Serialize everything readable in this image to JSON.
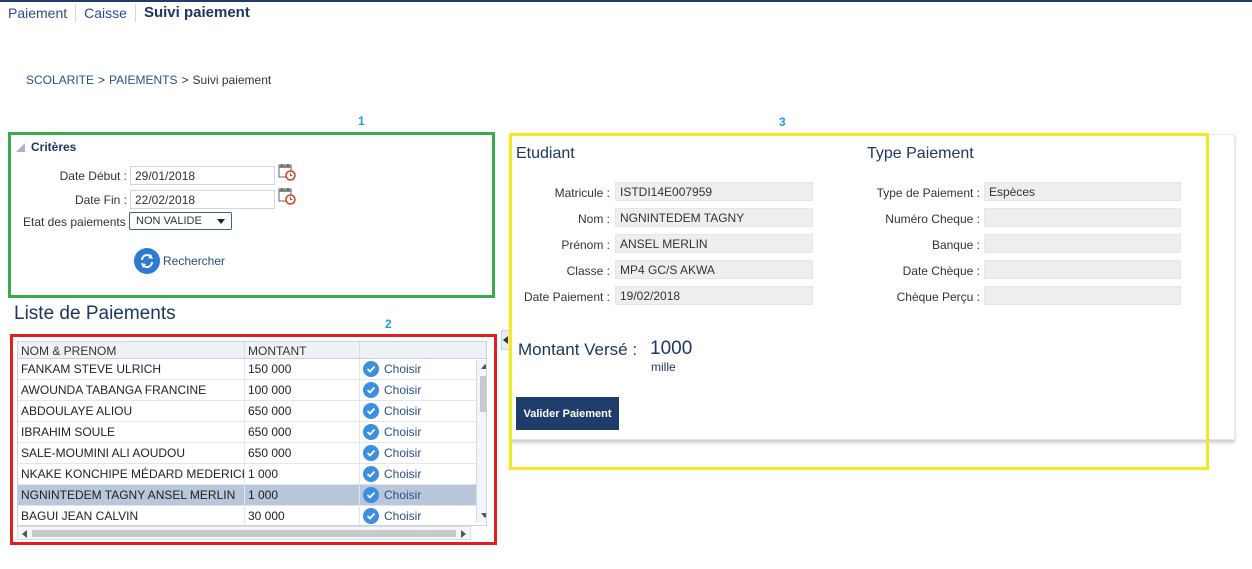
{
  "tabs": [
    {
      "label": "Paiement"
    },
    {
      "label": "Caisse"
    },
    {
      "label": "Suivi paiement"
    }
  ],
  "breadcrumb": {
    "items": [
      "SCOLARITE",
      "PAIEMENTS",
      "Suivi paiement"
    ],
    "separator": ">"
  },
  "badges": {
    "criteria": "1",
    "list": "2",
    "detail": "3"
  },
  "criteria": {
    "title": "Critères",
    "date_debut_label": "Date Début :",
    "date_debut_value": "29/01/2018",
    "date_fin_label": "Date Fin :",
    "date_fin_value": "22/02/2018",
    "etat_label": "Etat des paiements",
    "etat_value": "NON VALIDE",
    "search_label": "Rechercher"
  },
  "list": {
    "title": "Liste de Paiements",
    "columns": [
      "NOM & PRENOM",
      "MONTANT",
      ""
    ],
    "choose_label": "Choisir",
    "rows": [
      {
        "name": "FANKAM STEVE ULRICH",
        "amount": "150 000"
      },
      {
        "name": "AWOUNDA TABANGA FRANCINE",
        "amount": "100 000"
      },
      {
        "name": "ABDOULAYE ALIOU",
        "amount": "650 000"
      },
      {
        "name": "IBRAHIM SOULE",
        "amount": "650 000"
      },
      {
        "name": "SALE-MOUMINI ALI AOUDOU",
        "amount": "650 000"
      },
      {
        "name": "NKAKE KONCHIPE MÉDARD MEDERICK",
        "amount": "1 000"
      },
      {
        "name": "NGNINTEDEM TAGNY ANSEL MERLIN",
        "amount": "1 000"
      },
      {
        "name": "BAGUI JEAN CALVIN",
        "amount": "30 000"
      }
    ]
  },
  "etudiant": {
    "title": "Etudiant",
    "matricule_label": "Matricule :",
    "matricule": "ISTDI14E007959",
    "nom_label": "Nom :",
    "nom": "NGNINTEDEM TAGNY",
    "prenom_label": "Prénom :",
    "prenom": "ANSEL MERLIN",
    "classe_label": "Classe :",
    "classe": "MP4 GC/S AKWA",
    "date_paiement_label": "Date Paiement :",
    "date_paiement": "19/02/2018"
  },
  "type_paiement": {
    "title": "Type Paiement",
    "type_label": "Type de Paiement :",
    "type": "Espèces",
    "numero_label": "Numéro Cheque :",
    "numero": "",
    "banque_label": "Banque :",
    "banque": "",
    "date_cheque_label": "Date Chèque :",
    "date_cheque": "",
    "cheque_percu_label": "Chèque Perçu :",
    "cheque_percu": ""
  },
  "montant": {
    "label": "Montant Versé :",
    "value": "1000",
    "words": "mille"
  },
  "valider_label": "Valider Paiement",
  "colors": {
    "criteria_border": "#3aab4a",
    "list_border": "#e02020",
    "detail_border": "#f4e81e",
    "primary": "#1f3d6b",
    "badge": "#1aa0e6"
  }
}
